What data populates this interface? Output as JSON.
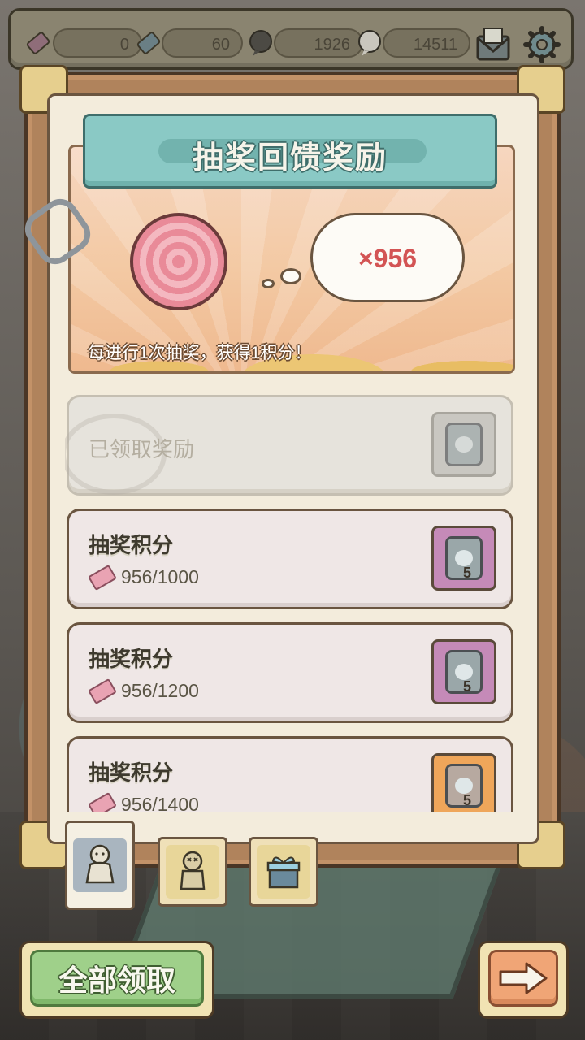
{
  "resources": [
    {
      "icon": "pink-ticket-icon",
      "value": "0"
    },
    {
      "icon": "blue-ticket-icon",
      "value": "60"
    },
    {
      "icon": "dark-soul-icon",
      "value": "1926"
    },
    {
      "icon": "grey-soul-icon",
      "value": "14511"
    }
  ],
  "top_buttons": [
    {
      "icon": "mail-icon"
    },
    {
      "icon": "gear-icon"
    }
  ],
  "panel": {
    "title": "抽奖回馈奖励",
    "points": "×956",
    "caption": "每进行1次抽奖，获得1积分！"
  },
  "rewards": [
    {
      "state": "claimed",
      "label": "已领取奖励",
      "reward_color": "grey"
    },
    {
      "state": "open",
      "title": "抽奖积分",
      "progress": "956/1000",
      "reward_color": "purple",
      "count": "5"
    },
    {
      "state": "open",
      "title": "抽奖积分",
      "progress": "956/1200",
      "reward_color": "purple",
      "count": "5"
    },
    {
      "state": "open",
      "title": "抽奖积分",
      "progress": "956/1400",
      "reward_color": "orange",
      "count": "5"
    }
  ],
  "tabs": [
    {
      "icon": "voodoo-doll-icon",
      "active": true
    },
    {
      "icon": "stitched-doll-icon",
      "active": false
    },
    {
      "icon": "gift-box-icon",
      "active": false
    }
  ],
  "buttons": {
    "claim_all": "全部领取",
    "next_icon": "arrow-right-icon"
  },
  "colors": {
    "accent_green": "#9fd08a",
    "title_teal": "#8ac9c5",
    "points_red": "#d35454"
  }
}
